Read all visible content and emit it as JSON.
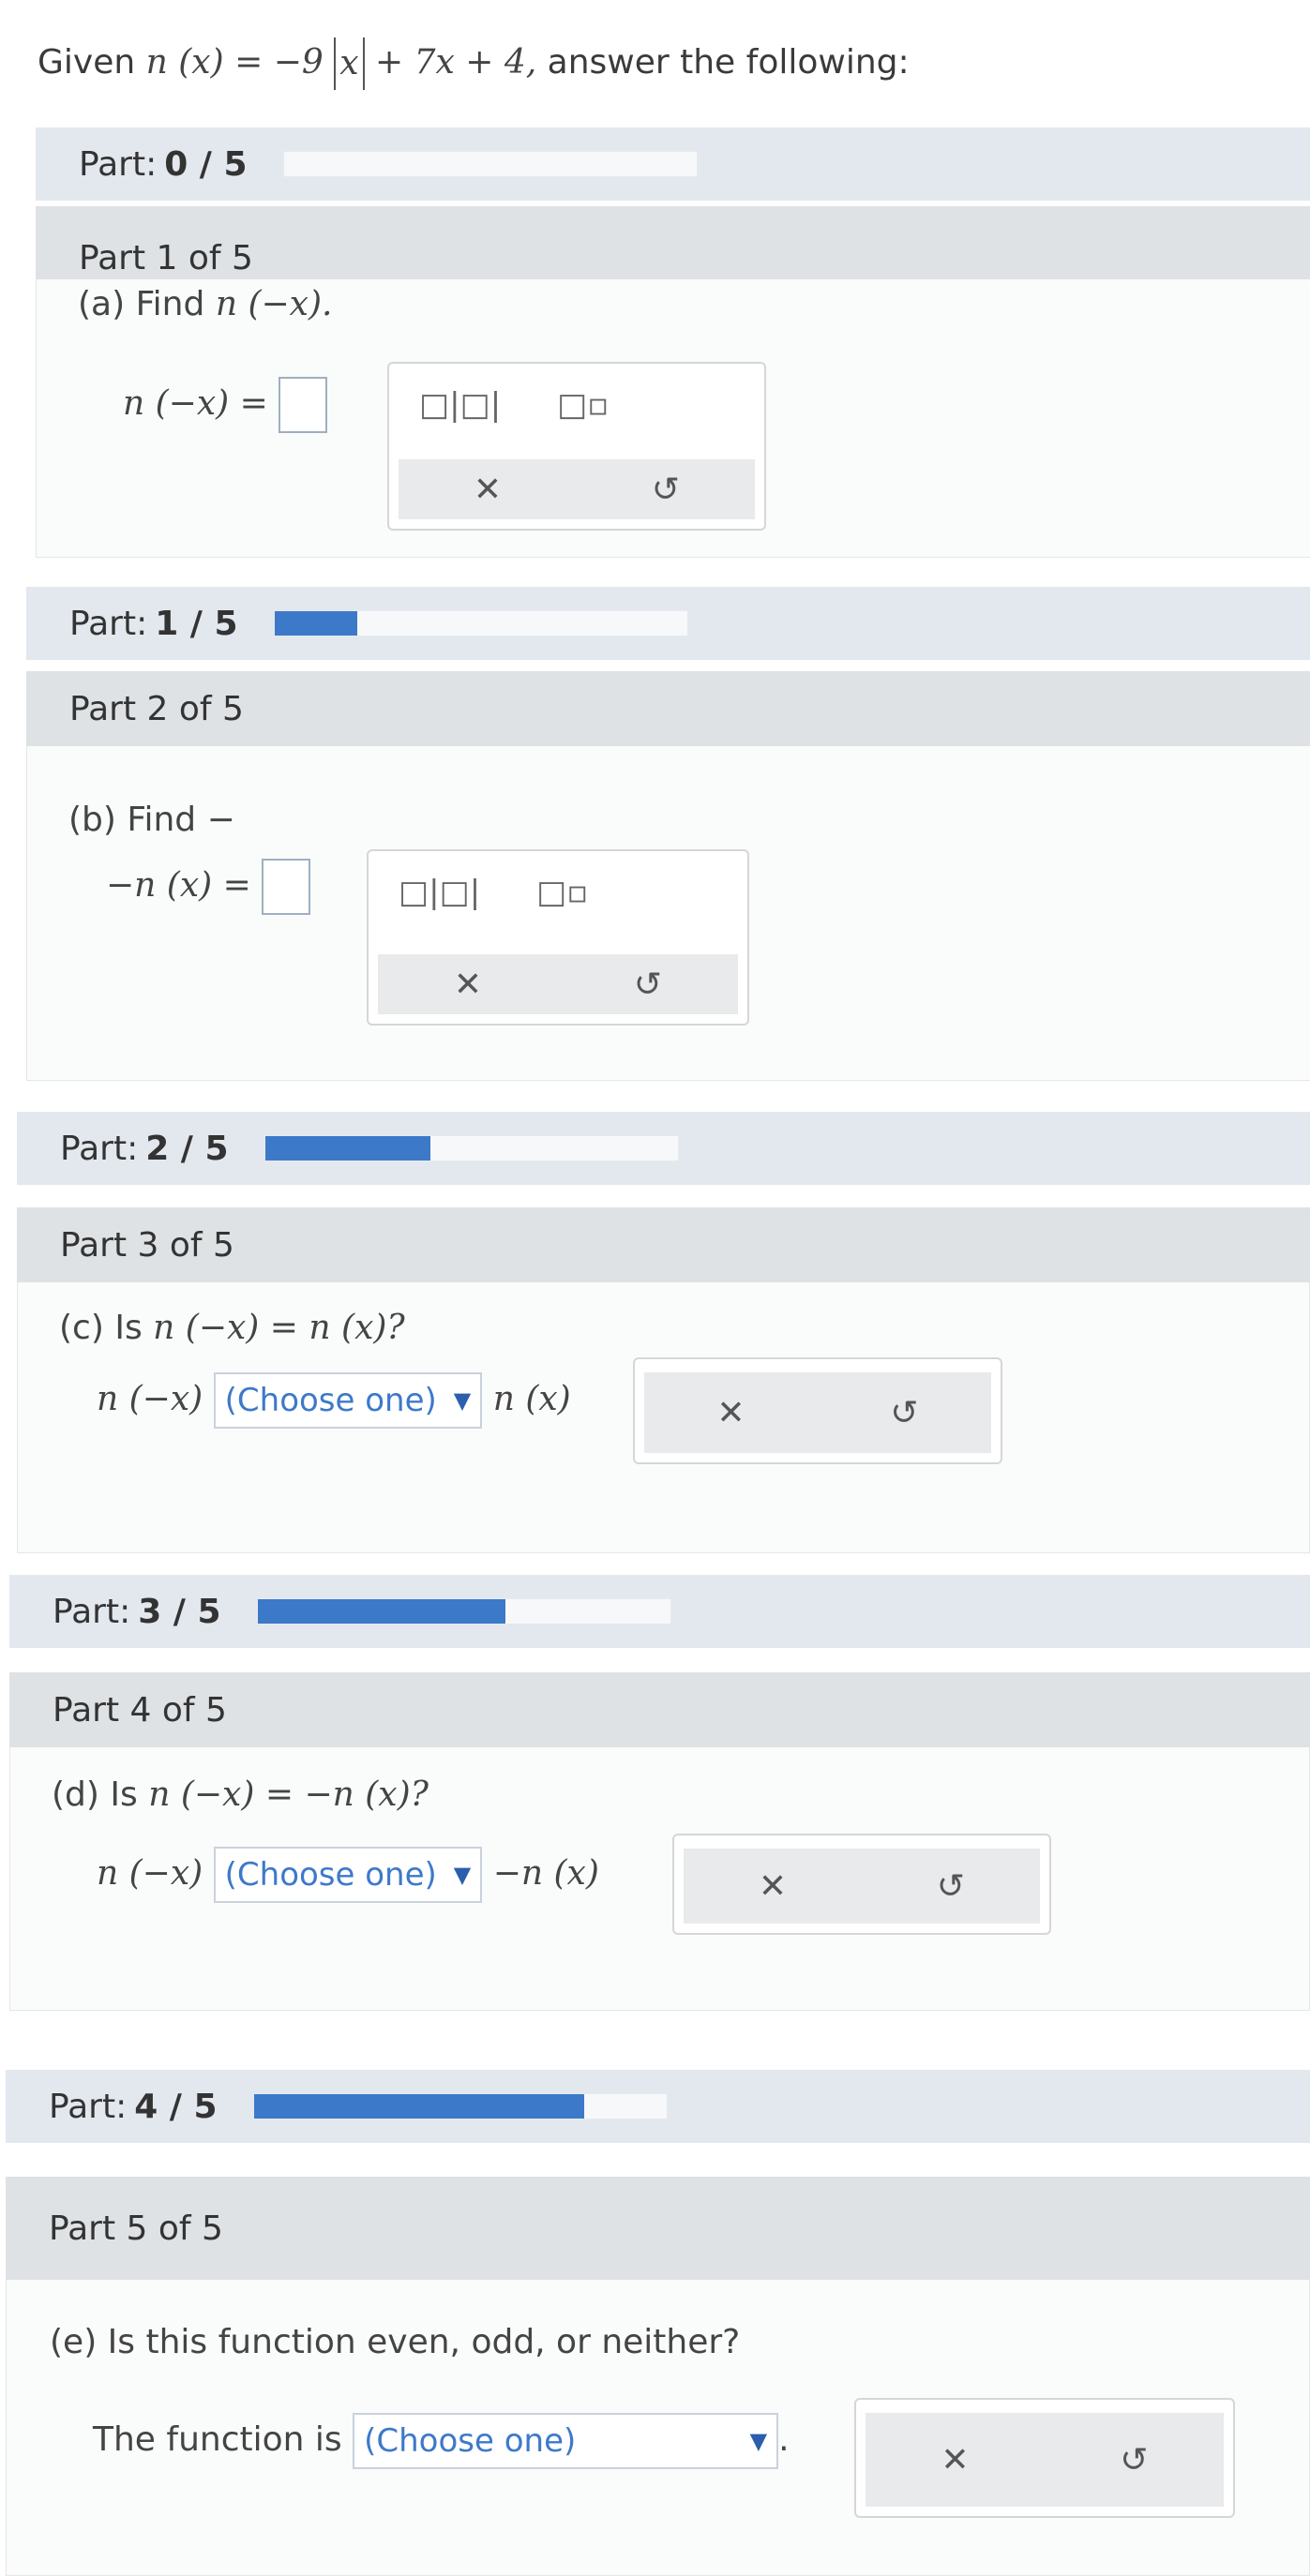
{
  "intro": {
    "given": "Given",
    "lhs": "n (x) = −9",
    "abs_inner": "x",
    "rhs": "+ 7x + 4,",
    "suffix": "answer the following:"
  },
  "progress": [
    {
      "label": "Part:",
      "value": "0 / 5",
      "fraction": 0.0
    },
    {
      "label": "Part:",
      "value": "1 / 5",
      "fraction": 0.2
    },
    {
      "label": "Part:",
      "value": "2 / 5",
      "fraction": 0.4
    },
    {
      "label": "Part:",
      "value": "3 / 5",
      "fraction": 0.6
    },
    {
      "label": "Part:",
      "value": "4 / 5",
      "fraction": 0.8
    }
  ],
  "parts": [
    {
      "heading": "Part 1 of 5",
      "question": "(a) Find",
      "question_math": "n (−x).",
      "answer_label": "n (−x) ="
    },
    {
      "heading": "Part 2 of 5",
      "question": "(b) Find −",
      "answer_label": "−n (x) ="
    },
    {
      "heading": "Part 3 of 5",
      "question": "(c) Is",
      "question_math": "n (−x) = n (x)?",
      "lhs": "n (−x)",
      "select": "(Choose one)",
      "rhs": "n (x)"
    },
    {
      "heading": "Part 4 of 5",
      "question": "(d) Is",
      "question_math": "n (−x) = −n (x)?",
      "lhs": "n (−x)",
      "select": "(Choose one)",
      "rhs": "−n (x)"
    },
    {
      "heading": "Part 5 of 5",
      "question": "(e) Is this function even, odd, or neither?",
      "prefix": "The function is",
      "select": "(Choose one)",
      "suffix": "."
    }
  ],
  "tools": {
    "fraction_icon": "□|□|",
    "superscript_icon": "□▫",
    "clear_icon": "✕",
    "undo_icon": "↺",
    "dropdown_arrow": "▼"
  }
}
